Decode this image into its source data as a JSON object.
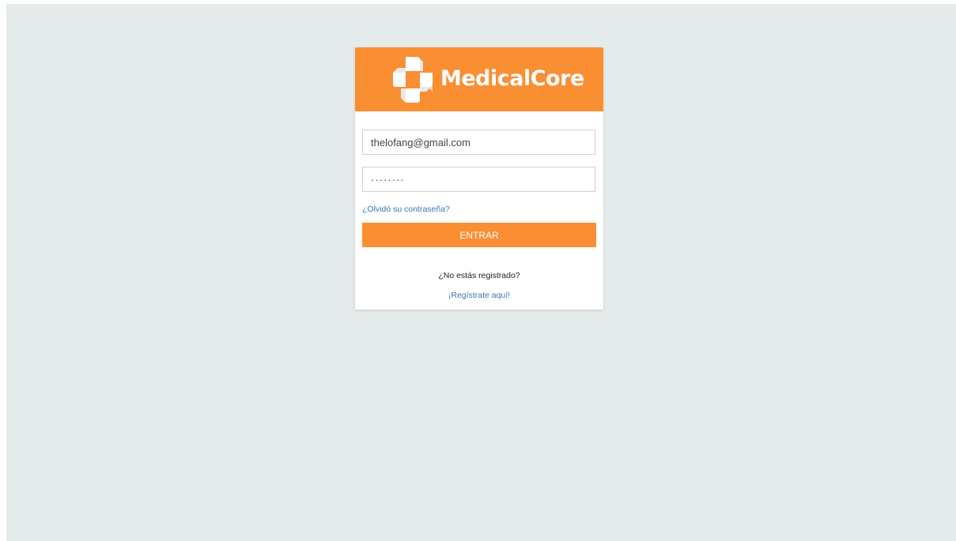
{
  "brand": {
    "name": "MedicalCore",
    "icon": "medical-cross-icon",
    "color": "#fa8e32"
  },
  "login": {
    "email_value": "thelofang@gmail.com",
    "password_value": "········",
    "forgot_label": "¿Olvidó su contraseña?",
    "submit_label": "ENTRAR",
    "not_registered_text": "¿No estás registrado?",
    "register_label": "¡Regístrate aquí!"
  },
  "colors": {
    "background": "#e5eaea",
    "link": "#3a76b4"
  }
}
